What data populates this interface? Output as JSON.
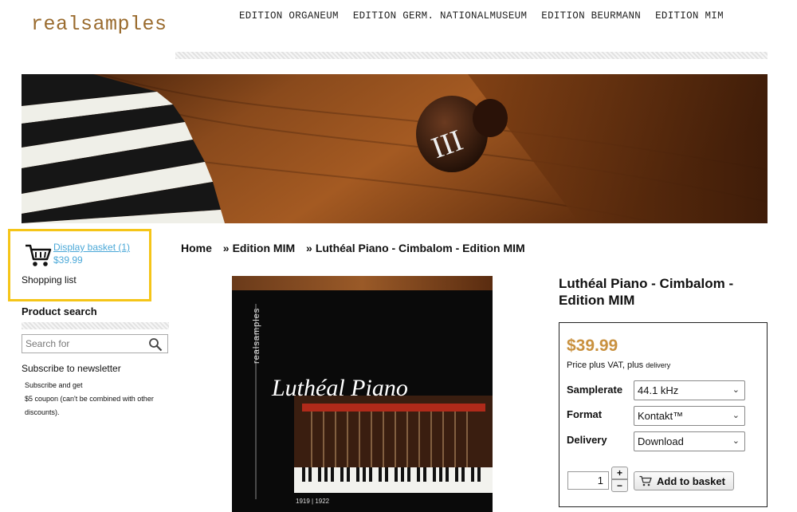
{
  "header": {
    "logo": "realsamples",
    "nav": [
      "EDITION ORGANEUM",
      "EDITION GERM. NATIONALMUSEUM",
      "EDITION BEURMANN",
      "EDITION MIM"
    ]
  },
  "sidebar": {
    "basket_link": "Display basket (1)",
    "basket_total": "$39.99",
    "shopping_list": "Shopping list",
    "product_search_heading": "Product search",
    "search_placeholder": "Search for",
    "newsletter_title": "Subscribe to newsletter",
    "newsletter_text_1": "Subscribe and get",
    "newsletter_text_2": "$5 coupon (can't be combined with other discounts)."
  },
  "breadcrumb": {
    "home": "Home",
    "sep": "»",
    "category": "Edition MIM",
    "current": "Luthéal Piano - Cimbalom - Edition MIM"
  },
  "product_image": {
    "vertical_brand": "realsamples",
    "script_title": "Luthéal Piano",
    "years": "1919 | 1922"
  },
  "product": {
    "title": "Luthéal Piano - Cimbalom - Edition MIM",
    "price": "$39.99",
    "price_note": "Price plus VAT, plus",
    "price_note_small": "delivery",
    "options": [
      {
        "label": "Samplerate",
        "value": "44.1 kHz"
      },
      {
        "label": "Format",
        "value": "Kontakt™"
      },
      {
        "label": "Delivery",
        "value": "Download"
      }
    ],
    "quantity": "1",
    "plus": "+",
    "minus": "−",
    "add_to_basket": "Add to basket"
  },
  "colors": {
    "accent_gold": "#c9913f",
    "link_blue": "#4aa8d8",
    "highlight_yellow": "#f5c518",
    "logo_brown": "#9a6b2e"
  }
}
